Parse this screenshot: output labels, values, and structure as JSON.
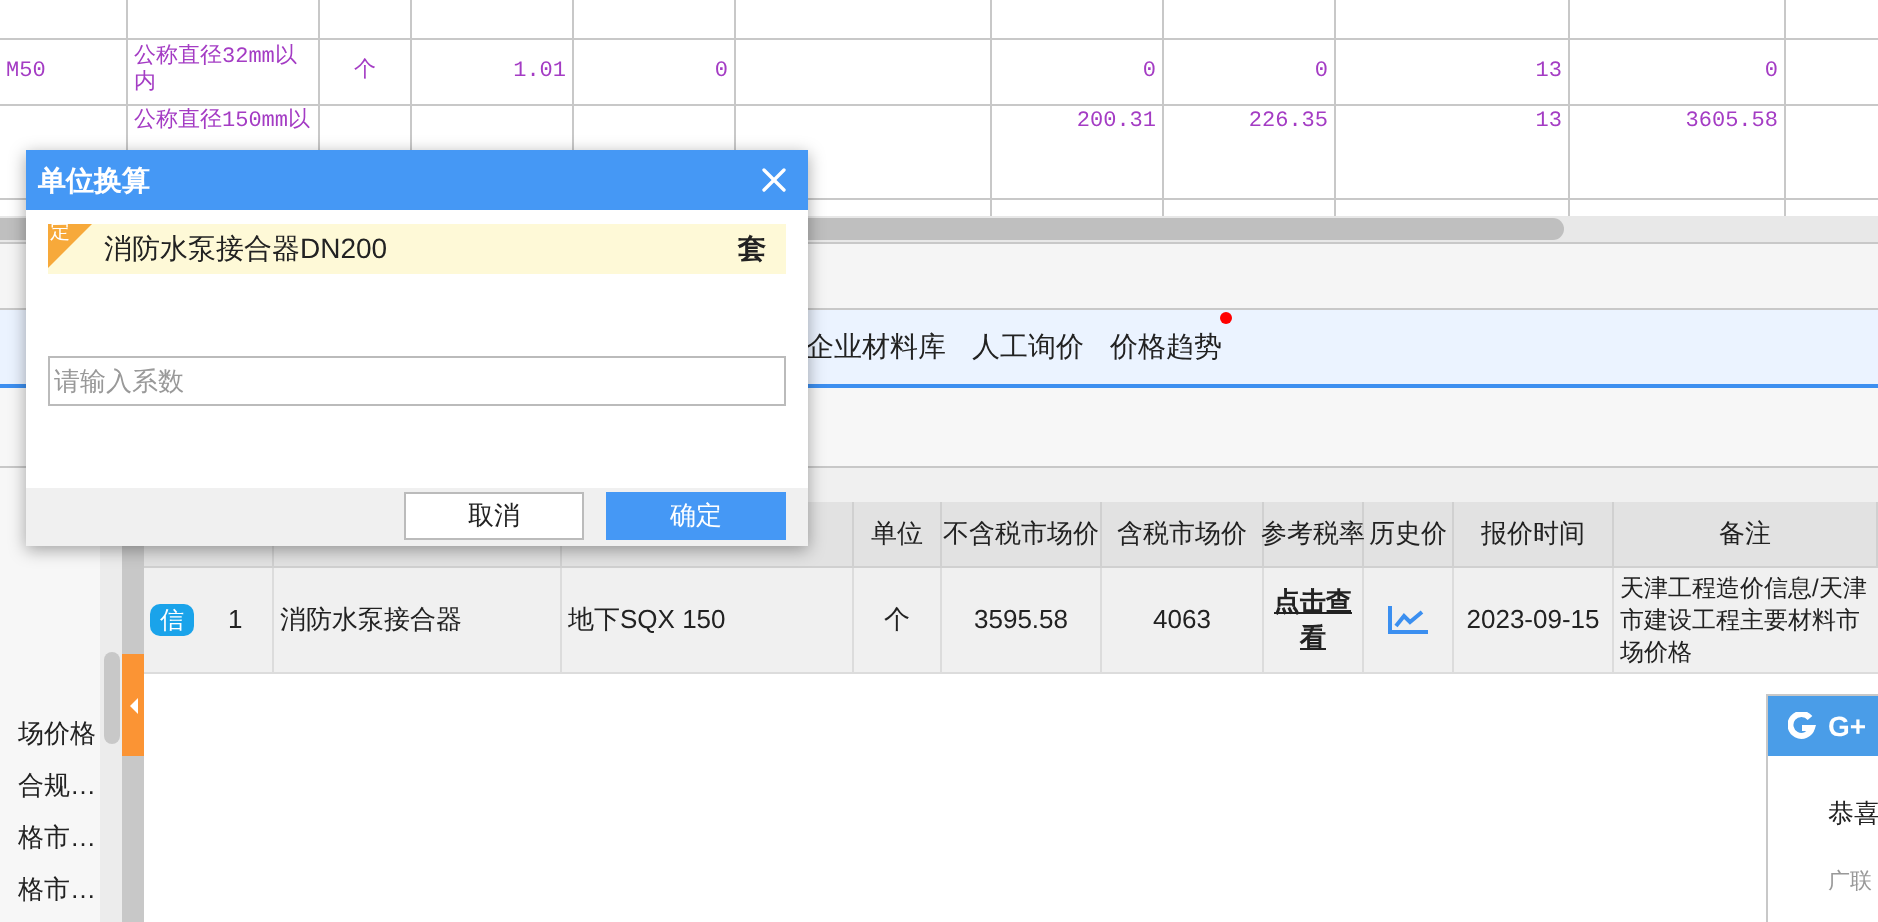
{
  "sheet": {
    "rows": [
      {
        "column_1": "M50",
        "column_2": "公称直径32mm以内",
        "column_3": "个",
        "column_4": "1.01",
        "column_5": "0",
        "column_7": "0",
        "column_8": "0",
        "column_9": "13",
        "column_10": "0"
      },
      {
        "column_2": "公称直径150mm以",
        "column_7": "200.31",
        "column_8": "226.35",
        "column_9": "13",
        "column_10": "3605.58"
      }
    ]
  },
  "tabs": [
    {
      "label": "企业材料库",
      "selected": false,
      "dot": false
    },
    {
      "label": "人工询价",
      "selected": false,
      "dot": false
    },
    {
      "label": "价格趋势",
      "selected": false,
      "dot": true
    }
  ],
  "sidebar": {
    "items": [
      "场价格",
      "合规…",
      "格市…",
      "格市…"
    ]
  },
  "table": {
    "columns": [
      "单位",
      "不含税市场价",
      "含税市场价",
      "参考税率",
      "历史价",
      "报价时间",
      "备注"
    ],
    "rows": [
      {
        "badge": "信",
        "number": "1",
        "name": "消防水泵接合器",
        "spec": "地下SQX 150",
        "unit": "个",
        "price_ex_tax": "3595.58",
        "price_inc_tax": "4063",
        "tax_rate_link": "点击查看",
        "date": "2023-09-15",
        "note": "天津工程造价信息/天津市建设工程主要材料市场价格"
      }
    ]
  },
  "popup": {
    "title": "G+",
    "line_1": "恭喜",
    "line_2": "广联"
  },
  "dialog": {
    "title": "单位换算",
    "item": {
      "badge": "定",
      "name": "消防水泵接合器DN200",
      "unit": "套"
    },
    "input": {
      "placeholder": "请输入系数"
    },
    "buttons": [
      {
        "label": "取消",
        "kind": "secondary"
      },
      {
        "label": "确定",
        "kind": "primary"
      }
    ]
  }
}
